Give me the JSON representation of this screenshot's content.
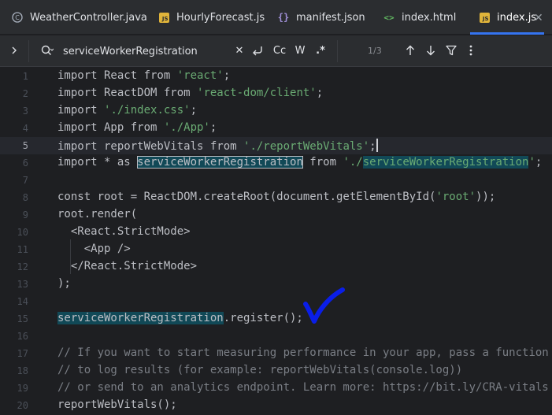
{
  "tabs": [
    {
      "label": "WeatherController.java",
      "icon": "java-class-icon"
    },
    {
      "label": "HourlyForecast.js",
      "icon": "js-file-icon"
    },
    {
      "label": "manifest.json",
      "icon": "json-file-icon"
    },
    {
      "label": "index.html",
      "icon": "html-file-icon"
    },
    {
      "label": "index.js",
      "icon": "js-file-icon",
      "active": true
    }
  ],
  "find": {
    "query": "serviceWorkerRegistration",
    "count": "1/3",
    "case_label": "Cc",
    "word_label": "W",
    "regex_label": ".*"
  },
  "code_lines": [
    {
      "n": "1"
    },
    {
      "n": "2"
    },
    {
      "n": "3"
    },
    {
      "n": "4"
    },
    {
      "n": "5"
    },
    {
      "n": "6"
    },
    {
      "n": "7"
    },
    {
      "n": "8"
    },
    {
      "n": "9"
    },
    {
      "n": "10"
    },
    {
      "n": "11"
    },
    {
      "n": "12"
    },
    {
      "n": "13"
    },
    {
      "n": "14"
    },
    {
      "n": "15"
    },
    {
      "n": "16"
    },
    {
      "n": "17"
    },
    {
      "n": "18"
    },
    {
      "n": "19"
    },
    {
      "n": "20"
    }
  ],
  "code": {
    "l1": {
      "a": "import React from ",
      "b": "'react'",
      "c": ";"
    },
    "l2": {
      "a": "import ReactDOM from ",
      "b": "'react-dom/client'",
      "c": ";"
    },
    "l3": {
      "a": "import ",
      "b": "'./index.css'",
      "c": ";"
    },
    "l4": {
      "a": "import App from ",
      "b": "'./App'",
      "c": ";"
    },
    "l5": {
      "a": "import reportWebVitals from ",
      "b": "'./reportWebVitals'",
      "c": ";"
    },
    "l6": {
      "a": "import * as ",
      "m1": "serviceWorkerRegistration",
      "b": " from ",
      "s1": "'./",
      "m2": "serviceWorkerRegistration",
      "s2": "'",
      "c": ";"
    },
    "l8": {
      "a": "const root = ReactDOM.createRoot(document.getElementById(",
      "b": "'root'",
      "c": "));"
    },
    "l9": "root.render(",
    "l10": "  <React.StrictMode>",
    "l11": "    <App />",
    "l12": "  </React.StrictMode>",
    "l13": ");",
    "l15": {
      "m": "serviceWorkerRegistration",
      "c": ".register();"
    },
    "l17": "// If you want to start measuring performance in your app, pass a function",
    "l18": "// to log results (for example: reportWebVitals(console.log))",
    "l19": "// or send to an analytics endpoint. Learn more: https://bit.ly/CRA-vitals",
    "l20": "reportWebVitals();"
  },
  "colors": {
    "accent": "#3574f0",
    "string": "#6aab73",
    "match_highlight": "#114957",
    "check_mark": "#0a1ee8"
  }
}
